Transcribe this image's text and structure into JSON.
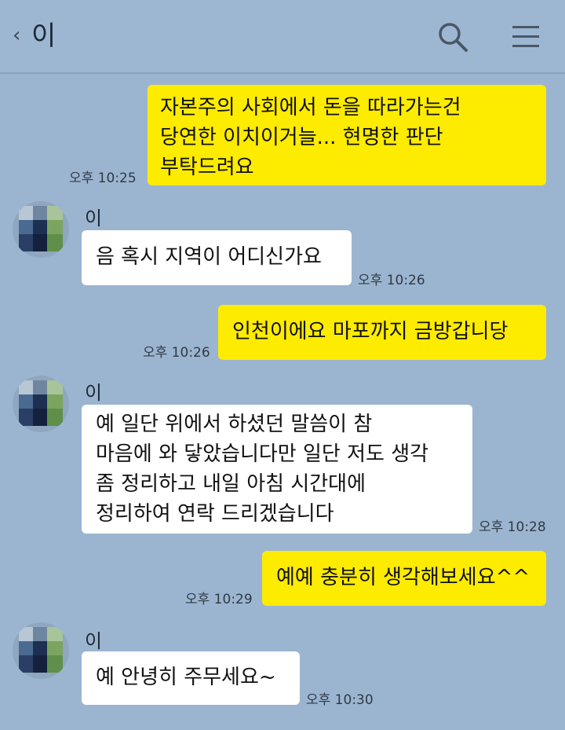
{
  "header": {
    "back_icon": "‹",
    "title": "이",
    "search_icon": "search-icon",
    "menu_icon": "menu-icon"
  },
  "messages": [
    {
      "side": "mine",
      "text": "자본주의 사회에서 돈을 따라가는건\n당연한 이치이거늘... 현명한 판단\n부탁드려요",
      "time": "오후 10:25"
    },
    {
      "side": "theirs",
      "sender": "이",
      "text": "음 혹시 지역이 어디신가요",
      "time": "오후 10:26"
    },
    {
      "side": "mine",
      "text": "인천이에요 마포까지 금방갑니당",
      "time": "오후 10:26"
    },
    {
      "side": "theirs",
      "sender": "이",
      "text": "예 일단 위에서 하셨던 말씀이 참\n마음에 와 닿았습니다만 일단 저도 생각\n좀 정리하고 내일 아침 시간대에\n정리하여 연락 드리겠습니다",
      "time": "오후 10:28"
    },
    {
      "side": "mine",
      "text": "예예 충분히 생각해보세요^^",
      "time": "오후 10:29"
    },
    {
      "side": "theirs",
      "sender": "이",
      "text": "예 안녕히 주무세요~",
      "time": "오후 10:30"
    }
  ],
  "colors": {
    "background": "#9bb5d1",
    "my_bubble": "#fdeb00",
    "their_bubble": "#ffffff"
  }
}
